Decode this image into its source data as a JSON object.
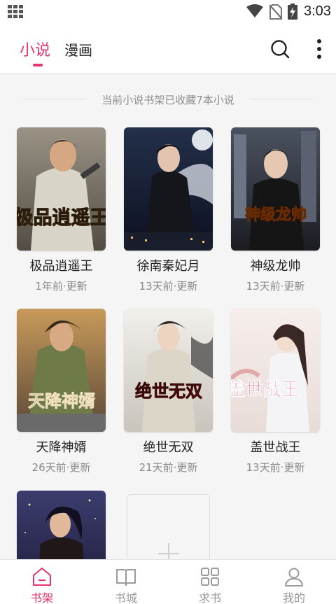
{
  "status_bar": {
    "time": "3:03",
    "icons": [
      "apps-grid-icon",
      "wifi-icon",
      "no-sim-icon",
      "battery-charging-icon"
    ]
  },
  "header": {
    "tabs": [
      {
        "label": "小说",
        "active": true
      },
      {
        "label": "漫画",
        "active": false
      }
    ],
    "actions": [
      "search-icon",
      "more-vertical-icon"
    ],
    "accent_color": "#e8336c"
  },
  "shelf": {
    "notice": "当前小说书架已收藏7本小说",
    "books": [
      {
        "title": "极品逍遥王",
        "updated": "1年前·更新",
        "cover_text": "极品逍遥王"
      },
      {
        "title": "徐南秦妃月",
        "updated": "13天前·更新",
        "cover_text": ""
      },
      {
        "title": "神级龙帅",
        "updated": "13天前·更新",
        "cover_text": "神级龙帅"
      },
      {
        "title": "天降神婿",
        "updated": "26天前·更新",
        "cover_text": "天降神婿"
      },
      {
        "title": "绝世无双",
        "updated": "21天前·更新",
        "cover_text": "绝世无双"
      },
      {
        "title": "盖世战王",
        "updated": "13天前·更新",
        "cover_text": "盖世战王"
      },
      {
        "title": "",
        "updated": "",
        "cover_text": ""
      }
    ],
    "add_icon": "plus-icon"
  },
  "bottom_nav": {
    "items": [
      {
        "label": "书架",
        "icon": "home-icon",
        "active": true
      },
      {
        "label": "书城",
        "icon": "book-open-icon",
        "active": false
      },
      {
        "label": "求书",
        "icon": "grid-icon",
        "active": false
      },
      {
        "label": "我的",
        "icon": "user-icon",
        "active": false
      }
    ]
  }
}
